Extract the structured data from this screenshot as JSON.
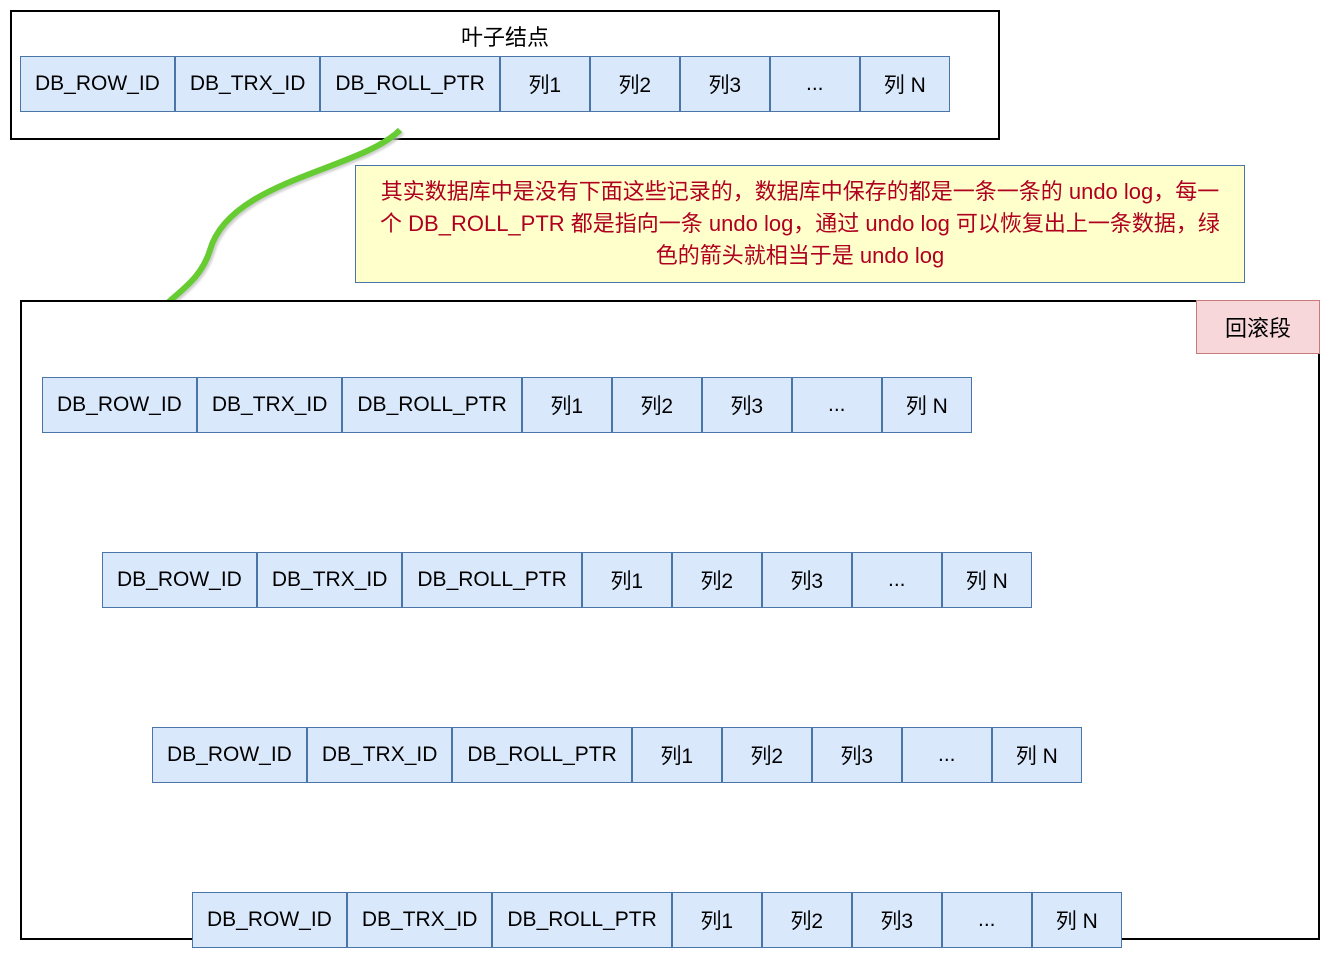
{
  "leaf": {
    "title": "叶子结点",
    "cells": [
      "DB_ROW_ID",
      "DB_TRX_ID",
      "DB_ROLL_PTR",
      "列1",
      "列2",
      "列3",
      "...",
      "列 N"
    ]
  },
  "annotation": "其实数据库中是没有下面这些记录的，数据库中保存的都是一条一条的 undo log，每一个 DB_ROLL_PTR 都是指向一条 undo log，通过 undo log 可以恢复出上一条数据，绿色的箭头就相当于是 undo log",
  "rollback": {
    "label": "回滚段",
    "rows": [
      [
        "DB_ROW_ID",
        "DB_TRX_ID",
        "DB_ROLL_PTR",
        "列1",
        "列2",
        "列3",
        "...",
        "列 N"
      ],
      [
        "DB_ROW_ID",
        "DB_TRX_ID",
        "DB_ROLL_PTR",
        "列1",
        "列2",
        "列3",
        "...",
        "列 N"
      ],
      [
        "DB_ROW_ID",
        "DB_TRX_ID",
        "DB_ROLL_PTR",
        "列1",
        "列2",
        "列3",
        "...",
        "列 N"
      ],
      [
        "DB_ROW_ID",
        "DB_TRX_ID",
        "DB_ROLL_PTR",
        "列1",
        "列2",
        "列3",
        "...",
        "列 N"
      ]
    ]
  },
  "arrows": {
    "color": "#66cc33"
  }
}
